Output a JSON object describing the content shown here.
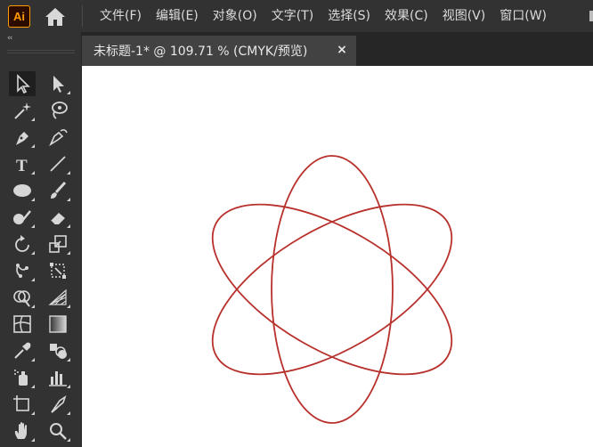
{
  "app": {
    "logo_text": "Ai",
    "brand_color": "#ff9a00"
  },
  "menu": {
    "items": [
      "文件(F)",
      "编辑(E)",
      "对象(O)",
      "文字(T)",
      "选择(S)",
      "效果(C)",
      "视图(V)",
      "窗口(W)"
    ]
  },
  "toolbar": {
    "collapse_label": "‹‹",
    "tools": [
      [
        "selection-tool-icon",
        "direct-selection-tool-icon"
      ],
      [
        "magic-wand-tool-icon",
        "lasso-tool-icon"
      ],
      [
        "pen-tool-icon",
        "curvature-tool-icon"
      ],
      [
        "type-tool-icon",
        "line-segment-tool-icon"
      ],
      [
        "ellipse-tool-icon",
        "paintbrush-tool-icon"
      ],
      [
        "shaper-tool-icon",
        "eraser-tool-icon"
      ],
      [
        "rotate-tool-icon",
        "scale-tool-icon"
      ],
      [
        "puppet-warp-tool-icon",
        "free-transform-tool-icon"
      ],
      [
        "shape-builder-tool-icon",
        "perspective-grid-tool-icon"
      ],
      [
        "mesh-tool-icon",
        "gradient-tool-icon"
      ],
      [
        "eyedropper-tool-icon",
        "blend-tool-icon"
      ],
      [
        "symbol-sprayer-tool-icon",
        "column-graph-tool-icon"
      ],
      [
        "artboard-tool-icon",
        "slice-tool-icon"
      ],
      [
        "hand-tool-icon",
        "zoom-tool-icon"
      ]
    ],
    "active_tool": "selection-tool-icon"
  },
  "document": {
    "tab_title": "未标题-1* @ 109.71 % (CMYK/预览)",
    "close_glyph": "×"
  },
  "artwork": {
    "shape": "three-ellipse-atom",
    "stroke_color": "#b8312c",
    "ellipse_rotations_deg": [
      0,
      60,
      -60
    ]
  }
}
